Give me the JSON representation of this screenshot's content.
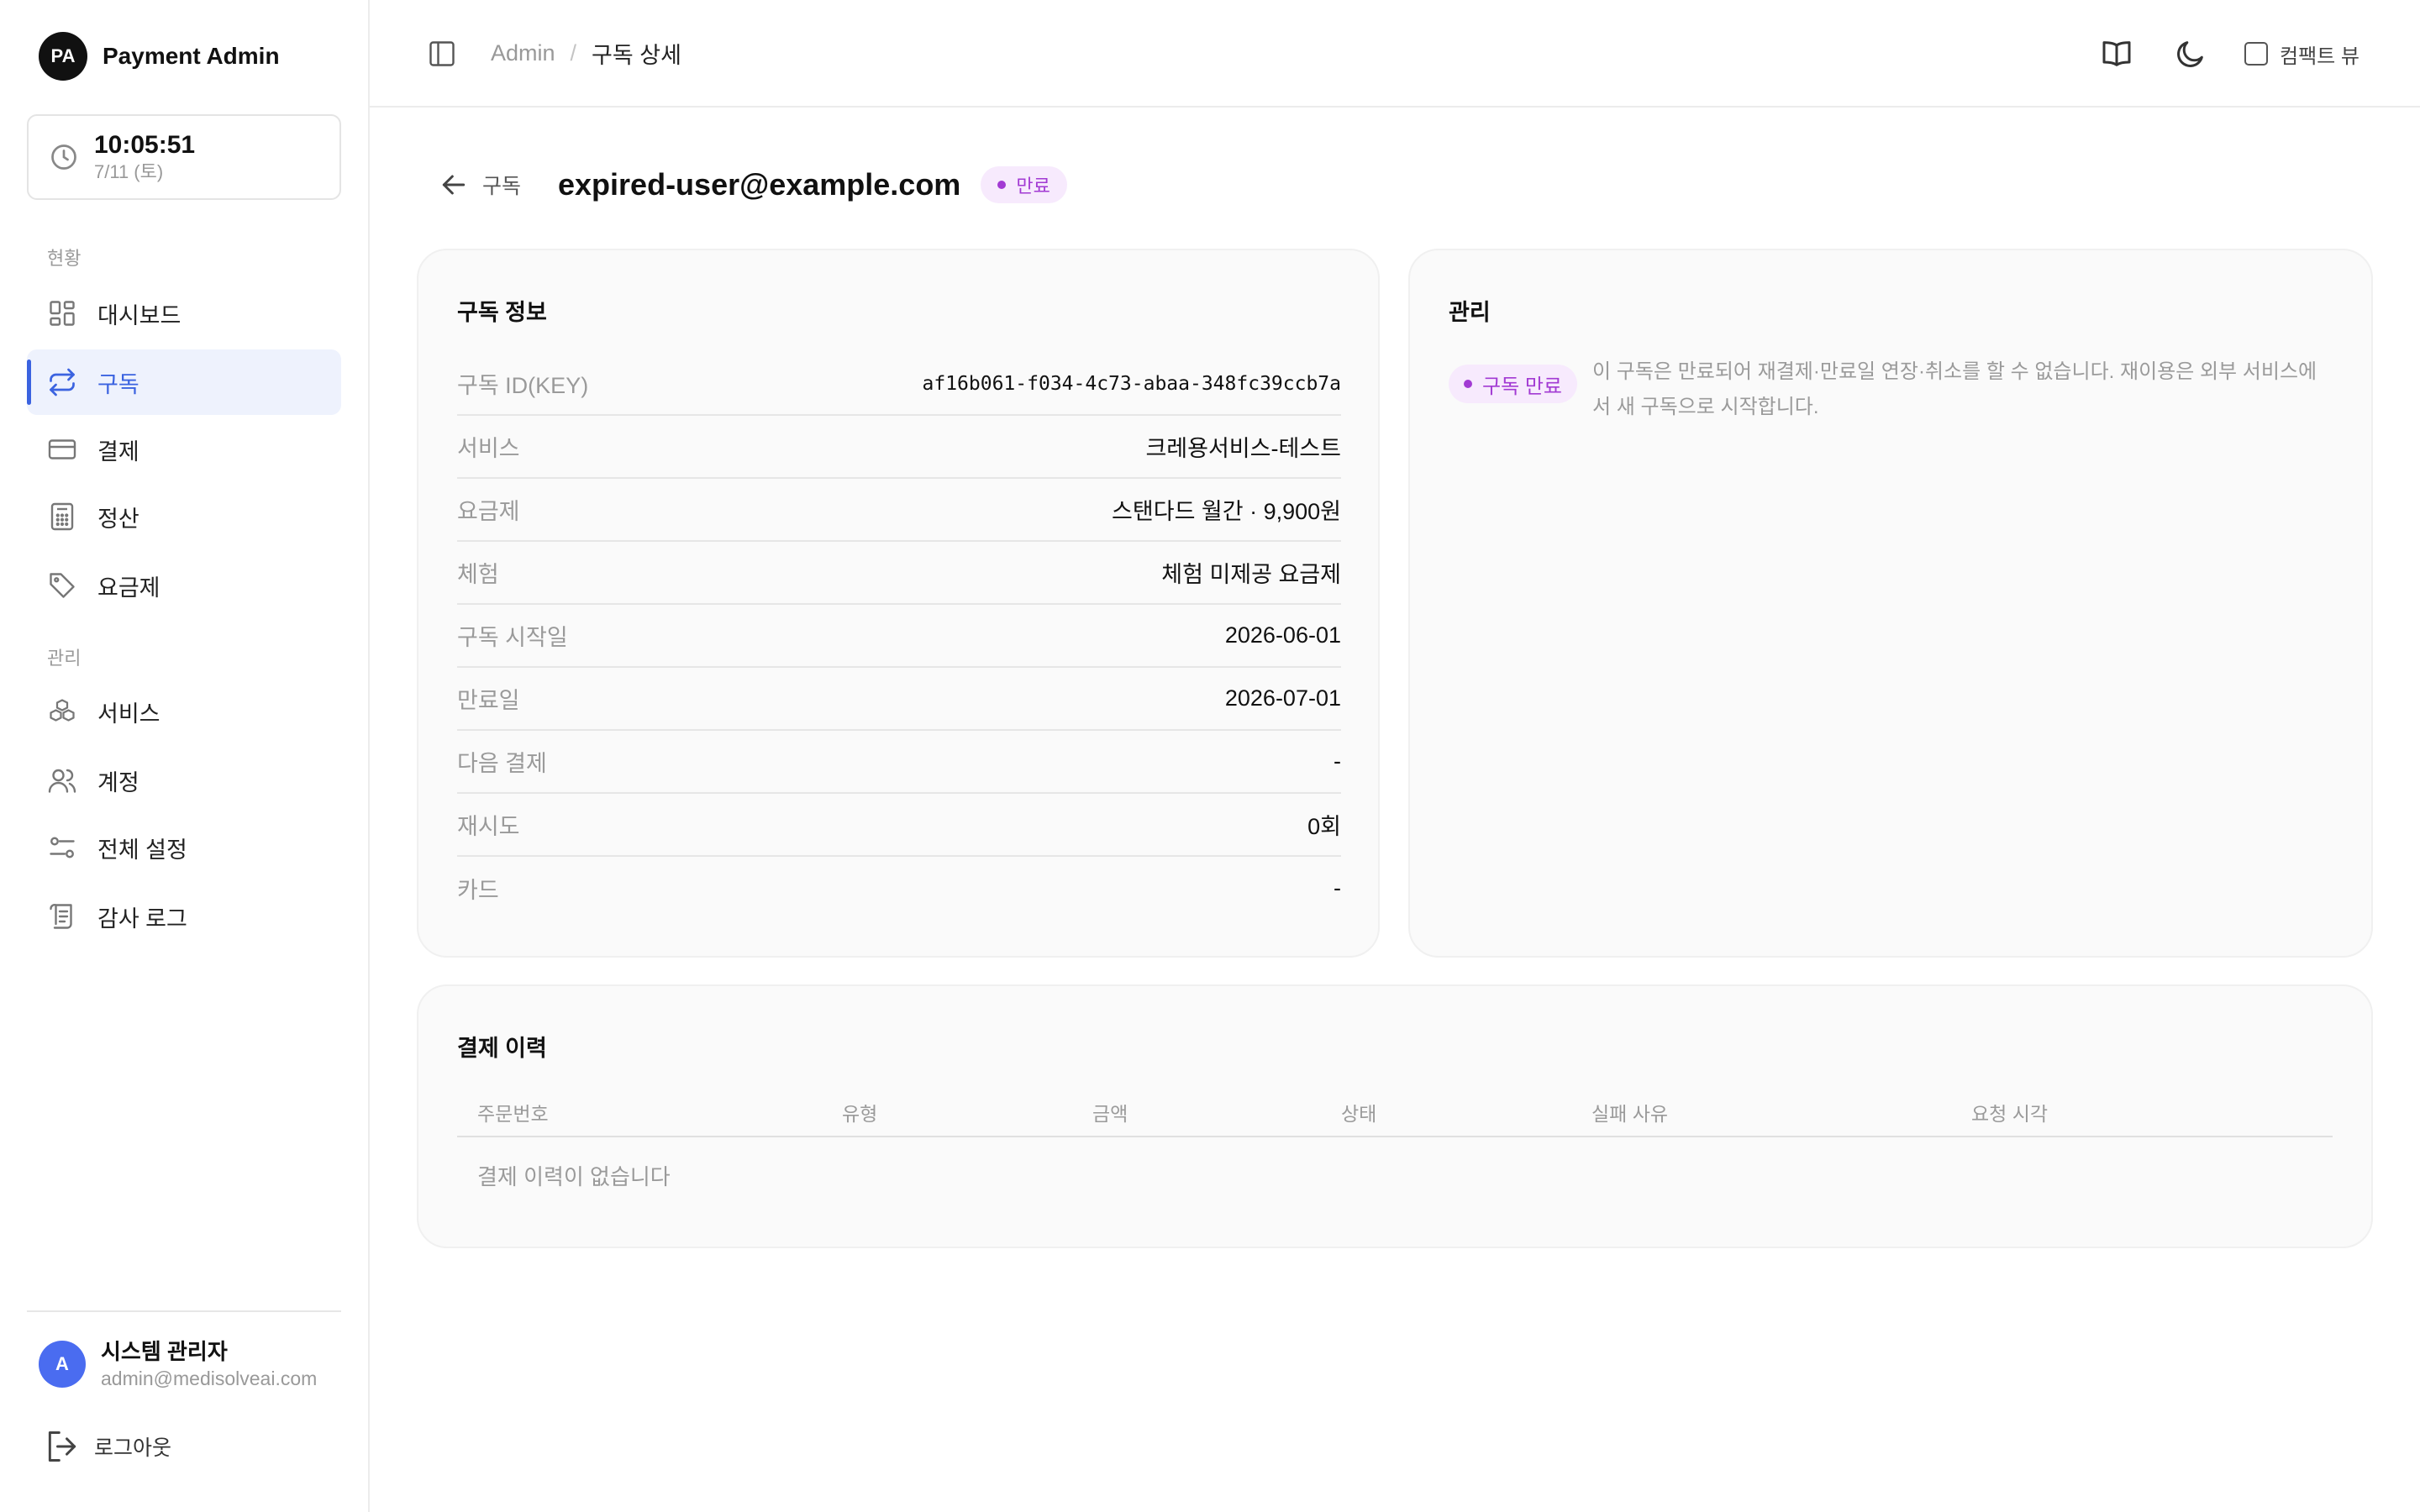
{
  "brand": {
    "initials": "PA",
    "name": "Payment Admin"
  },
  "clock": {
    "time": "10:05:51",
    "date": "7/11 (토)"
  },
  "nav": {
    "section_status": "현황",
    "section_manage": "관리",
    "items": [
      {
        "label": "대시보드",
        "icon": "dashboard-icon"
      },
      {
        "label": "구독",
        "icon": "repeat-icon",
        "active": true
      },
      {
        "label": "결제",
        "icon": "credit-card-icon"
      },
      {
        "label": "정산",
        "icon": "calculator-icon"
      },
      {
        "label": "요금제",
        "icon": "tag-icon"
      },
      {
        "label": "서비스",
        "icon": "boxes-icon"
      },
      {
        "label": "계정",
        "icon": "users-icon"
      },
      {
        "label": "전체 설정",
        "icon": "settings-sliders-icon"
      },
      {
        "label": "감사 로그",
        "icon": "scroll-icon"
      }
    ]
  },
  "user": {
    "initial": "A",
    "name": "시스템 관리자",
    "email": "admin@medisolveai.com"
  },
  "logout_label": "로그아웃",
  "topbar": {
    "breadcrumb_root": "Admin",
    "breadcrumb_sep": "/",
    "breadcrumb_current": "구독 상세",
    "compact_label": "컴팩트 뷰",
    "compact_checked": false
  },
  "page": {
    "back_label": "구독",
    "title": "expired-user@example.com",
    "status": "만료",
    "status_color": "#a23ad3",
    "status_bg": "#f7eafd"
  },
  "info": {
    "title": "구독 정보",
    "rows": [
      {
        "label": "구독 ID(KEY)",
        "value": "af16b061-f034-4c73-abaa-348fc39ccb7a"
      },
      {
        "label": "서비스",
        "value": "크레용서비스-테스트"
      },
      {
        "label": "요금제",
        "value": "스탠다드 월간 · 9,900원"
      },
      {
        "label": "체험",
        "value": "체험 미제공 요금제"
      },
      {
        "label": "구독 시작일",
        "value": "2026-06-01"
      },
      {
        "label": "만료일",
        "value": "2026-07-01"
      },
      {
        "label": "다음 결제",
        "value": "-"
      },
      {
        "label": "재시도",
        "value": "0회"
      },
      {
        "label": "카드",
        "value": "-"
      }
    ]
  },
  "manage": {
    "title": "관리",
    "badge": "구독 만료",
    "message": "이 구독은 만료되어 재결제·만료일 연장·취소를 할 수 없습니다. 재이용은 외부 서비스에서 새 구독으로 시작합니다."
  },
  "history": {
    "title": "결제 이력",
    "columns": [
      "주문번호",
      "유형",
      "금액",
      "상태",
      "실패 사유",
      "요청 시각"
    ],
    "empty_text": "결제 이력이 없습니다"
  },
  "colors": {
    "accent": "#3b63e0",
    "accent_bg": "#eef2fd",
    "avatar": "#4a6cf0"
  }
}
